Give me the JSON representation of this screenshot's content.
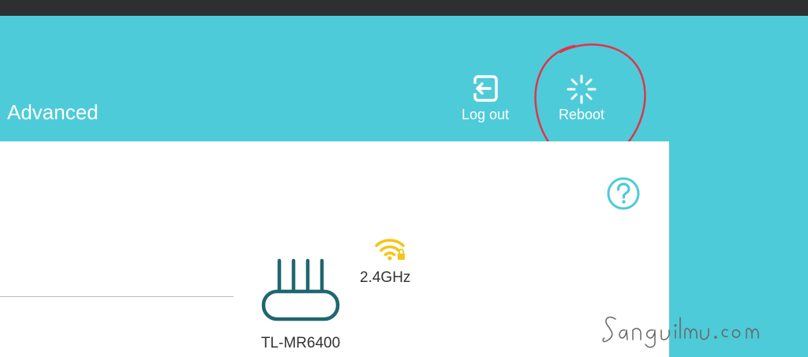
{
  "header": {
    "tab_label": "Advanced",
    "logout_label": "Log out",
    "reboot_label": "Reboot",
    "logout_icon": "logout-icon",
    "reboot_icon": "reboot-spinner-icon"
  },
  "panel": {
    "help_icon": "help-icon",
    "device": {
      "model": "TL-MR6400",
      "icon": "router-icon"
    },
    "wireless": {
      "band": "2.4GHz",
      "icon": "wifi-lock-icon"
    }
  },
  "overlay": {
    "watermark_text": "Sangilmu.com"
  },
  "colors": {
    "header_bg": "#4ecbd8",
    "top_strip": "#2e2f31",
    "panel_bg": "#ffffff",
    "router_stroke": "#1f6670",
    "wifi_fill": "#f5c518",
    "help_stroke": "#4ecbd8",
    "annotation_stroke": "#e0344b"
  }
}
